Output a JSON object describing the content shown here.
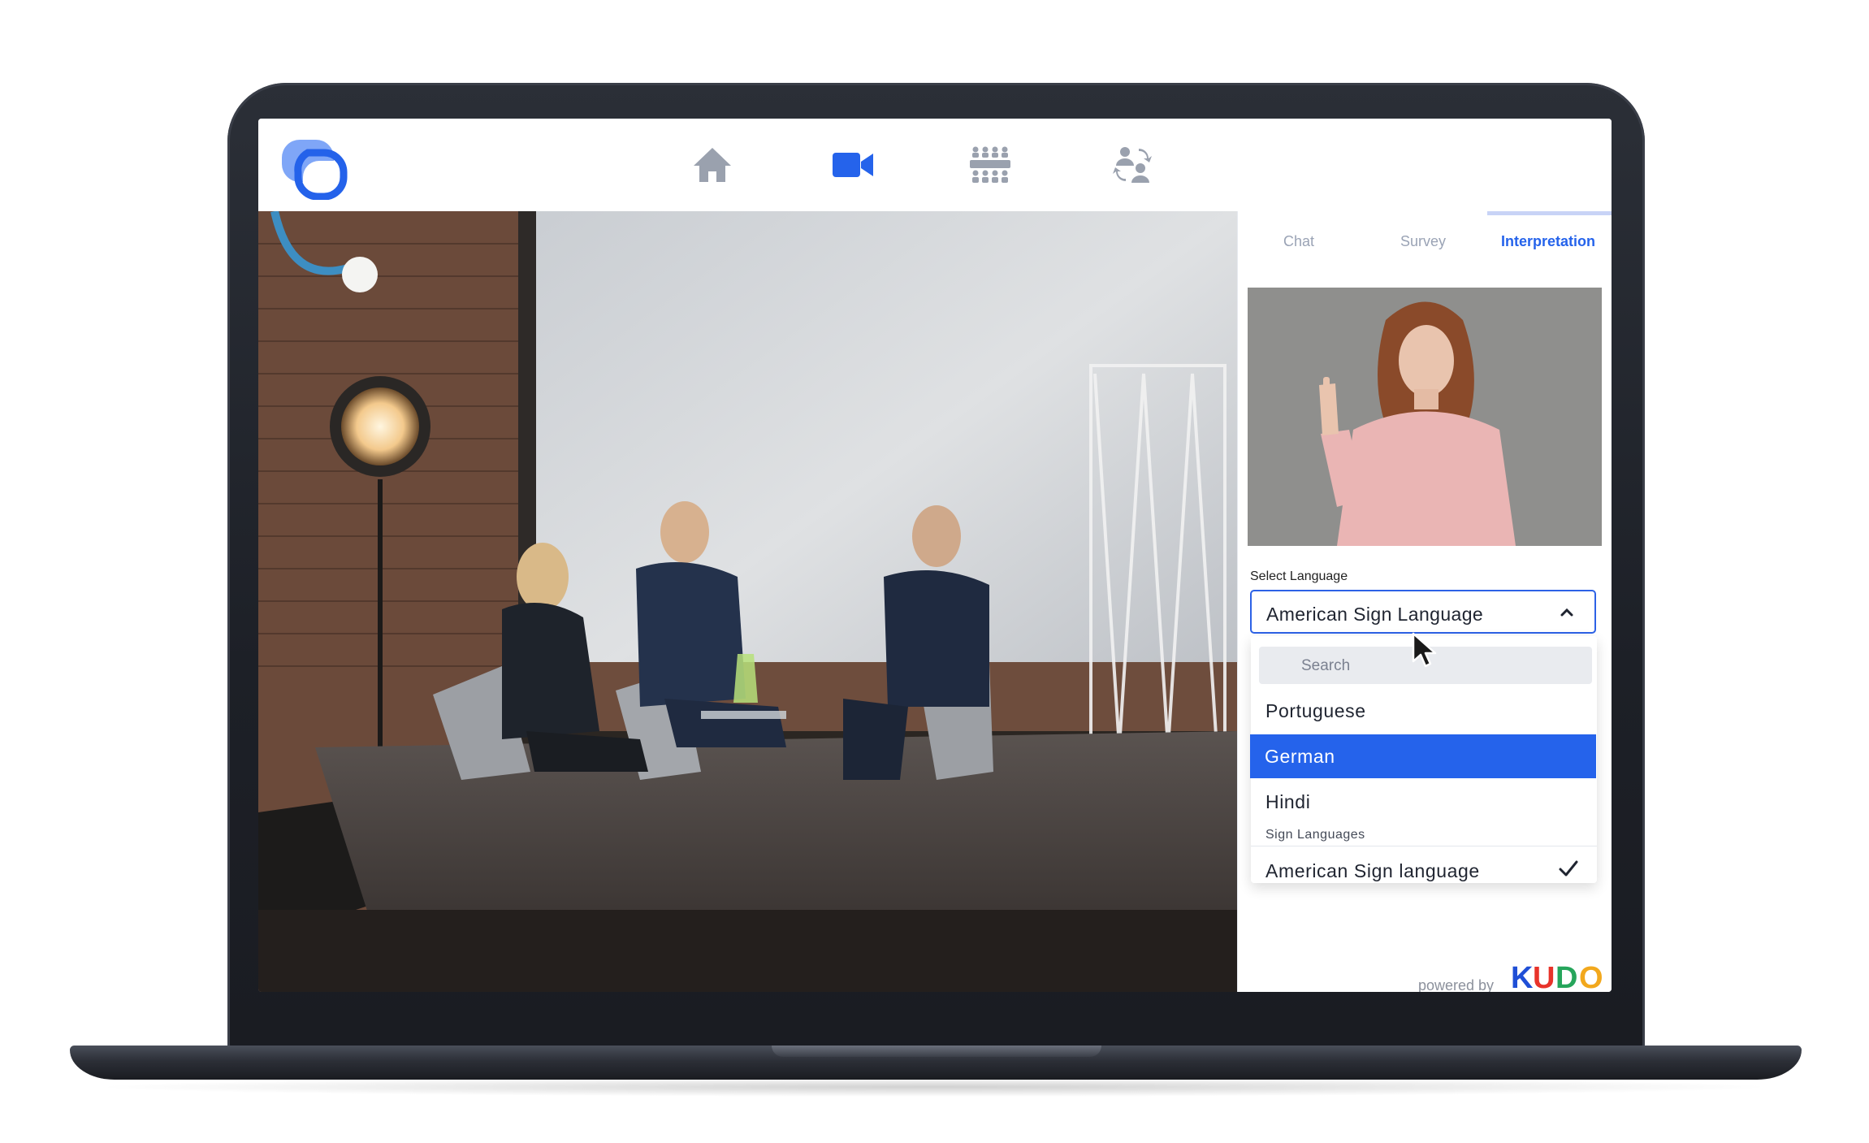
{
  "app": {
    "nav": [
      {
        "name": "home-icon"
      },
      {
        "name": "video-camera-icon",
        "active": true
      },
      {
        "name": "audience-icon"
      },
      {
        "name": "networking-icon"
      }
    ],
    "colors": {
      "accent": "#2563eb",
      "nav_inactive": "#9aa1ae",
      "kudo_k": "#1f4fd6",
      "kudo_u": "#e8332a",
      "kudo_d": "#26a55b",
      "kudo_o": "#f2a81d"
    }
  },
  "panel": {
    "tabs": [
      {
        "label": "Chat",
        "active": false
      },
      {
        "label": "Survey",
        "active": false
      },
      {
        "label": "Interpretation",
        "active": true
      }
    ],
    "select_label": "Select Language",
    "select_value": "American Sign Language",
    "dropdown": {
      "search_placeholder": "Search",
      "items": [
        {
          "label": "Portuguese"
        },
        {
          "label": "German",
          "highlighted": true
        },
        {
          "label": "Hindi"
        }
      ],
      "group_label": "Sign Languages",
      "group_items": [
        {
          "label": "American Sign language",
          "checked": true
        }
      ]
    },
    "powered_by": "powered by",
    "brand": "KUDO"
  }
}
